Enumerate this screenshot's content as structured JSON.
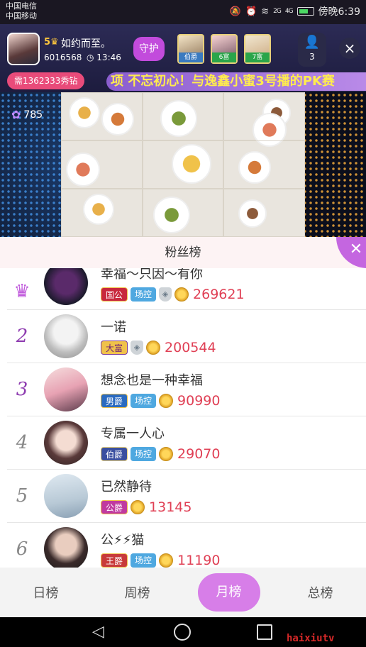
{
  "status_bar": {
    "carrier_1": "中国电信",
    "carrier_2": "中国移动",
    "signal_1": "2G",
    "signal_2": "4G",
    "time": "傍晚6:39"
  },
  "host": {
    "level": "5",
    "name": "如约而至。",
    "id": "6016568",
    "duration": "13:46",
    "guard_label": "守护"
  },
  "viewers": [
    {
      "tag": "伯爵"
    },
    {
      "tag": "6富"
    },
    {
      "tag": "7富"
    }
  ],
  "viewer_count": "3",
  "need_badge": "需1362333秀钻",
  "marquee": "项 不忘初心！与逸鑫小蜜3号播的PK赛",
  "flowers": "785",
  "panel": {
    "title": "粉丝榜"
  },
  "ranking": [
    {
      "rank": "1",
      "name": "幸福～只因～有你",
      "badges": [
        "国公",
        "场控"
      ],
      "shield": true,
      "score": "269621"
    },
    {
      "rank": "2",
      "name": "一诺",
      "badges": [
        "大富"
      ],
      "shield": true,
      "score": "200544"
    },
    {
      "rank": "3",
      "name": "想念也是一种幸福",
      "badges": [
        "男爵",
        "场控"
      ],
      "shield": false,
      "score": "90990"
    },
    {
      "rank": "4",
      "name": "专属一人心",
      "badges": [
        "伯爵",
        "场控"
      ],
      "shield": false,
      "score": "29070"
    },
    {
      "rank": "5",
      "name": "已然静待",
      "badges": [
        "公爵"
      ],
      "shield": false,
      "score": "13145"
    },
    {
      "rank": "6",
      "name": "公⚡⚡猫",
      "badges": [
        "王爵",
        "场控"
      ],
      "shield": false,
      "score": "11190"
    }
  ],
  "tabs": [
    {
      "label": "日榜",
      "active": false
    },
    {
      "label": "周榜",
      "active": false
    },
    {
      "label": "月榜",
      "active": true
    },
    {
      "label": "总榜",
      "active": false
    }
  ],
  "watermark": "haixiutv",
  "colors": {
    "accent": "#c466e0",
    "score": "#e04055",
    "active_tab": "#d77ee8"
  }
}
